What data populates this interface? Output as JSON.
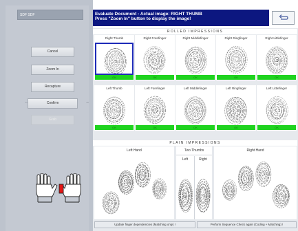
{
  "left_panel": {
    "user_field": "SDF SDF",
    "buttons": {
      "cancel": "Cancel",
      "zoom_in": "Zoom In",
      "recapture": "Recapture",
      "confirm": "Confirm",
      "grab": "Grab"
    },
    "arrows": {
      "left": "←",
      "right": "→"
    }
  },
  "header": {
    "message_line1": "Evaluate Document - Actual image: RIGHT THUMB",
    "message_line2": "Press \"Zoom In\" button to display the image!"
  },
  "rolled": {
    "title": "ROLLED IMPRESSIONS",
    "right": [
      {
        "label": "Right Thumb",
        "status": "OK"
      },
      {
        "label": "Right Forefinger",
        "status": "OK"
      },
      {
        "label": "Right Middlefinger",
        "status": "OK"
      },
      {
        "label": "Right Ringfinger",
        "status": "OK"
      },
      {
        "label": "Right Littlefinger",
        "status": "OK"
      }
    ],
    "left": [
      {
        "label": "Left Thumb",
        "status": "OK"
      },
      {
        "label": "Left Forefinger",
        "status": "OK"
      },
      {
        "label": "Left Middlefinger",
        "status": "OK"
      },
      {
        "label": "Left Ringfinger",
        "status": "OK"
      },
      {
        "label": "Left Littlefinger",
        "status": "OK"
      }
    ]
  },
  "plain": {
    "title": "PLAIN IMPRESSIONS",
    "left_hand": "Left Hand",
    "two_thumbs": "Two Thumbs",
    "left": "Left",
    "right": "Right",
    "right_hand": "Right Hand"
  },
  "footer": {
    "update": "Update finger dependencies (Matching only) !",
    "check": "Perform Sequence Check again (Coding + Matching) !"
  },
  "colors": {
    "status_ok": "#1fd31f",
    "header_bg": "#0c1780",
    "selected_border": "#1d2ab8",
    "hand_selected": "#e31515"
  }
}
